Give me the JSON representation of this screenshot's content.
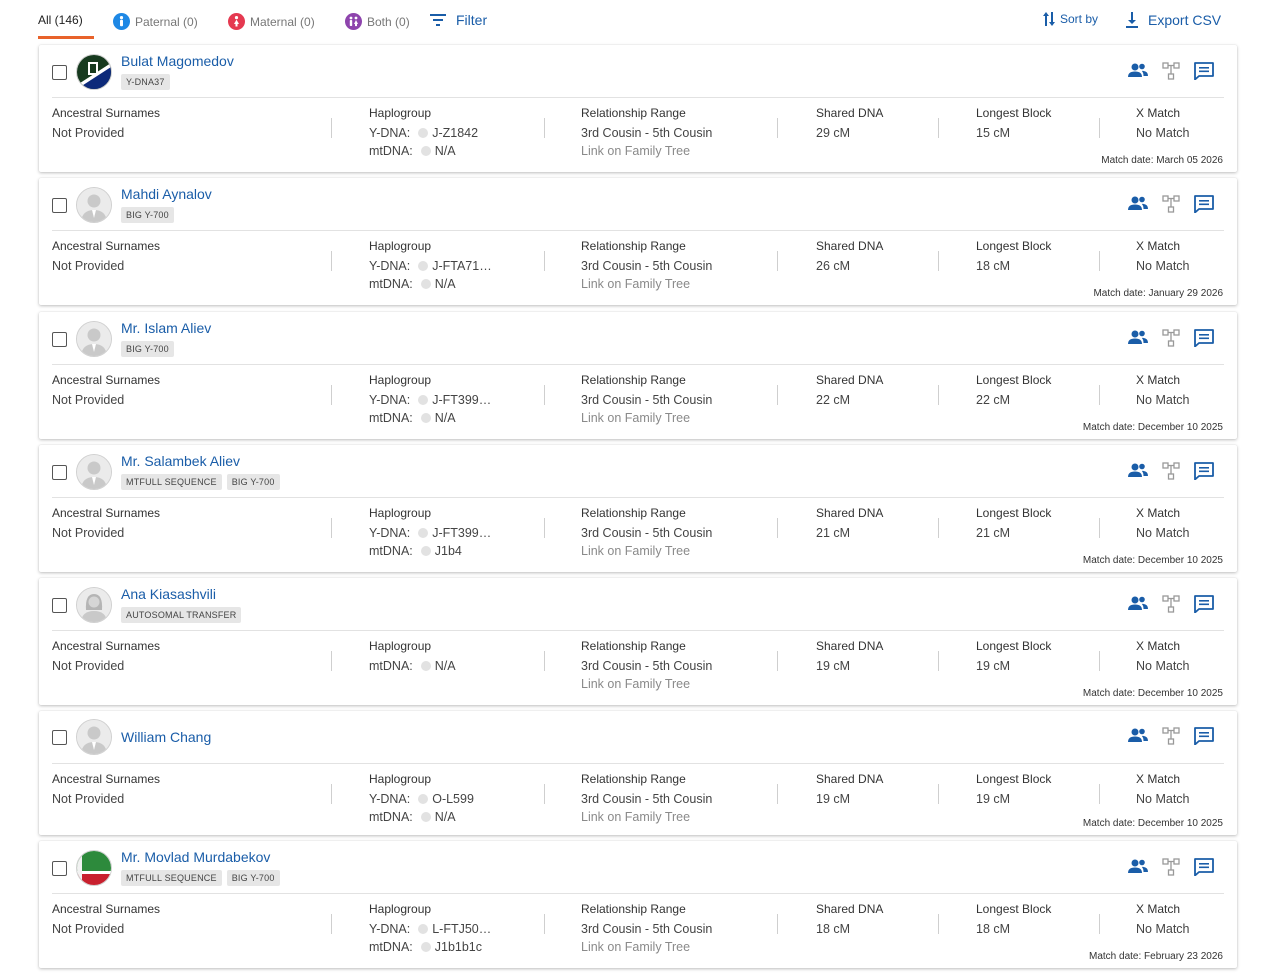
{
  "tabs": {
    "all": "All (146)",
    "paternal": "Paternal (0)",
    "maternal": "Maternal (0)",
    "both": "Both (0)"
  },
  "toolbar": {
    "filter": "Filter",
    "sort": "Sort by",
    "export": "Export CSV"
  },
  "colors": {
    "accent": "#1a5da8",
    "tab_active": "#e8622a",
    "paternal": "#1e88e5",
    "maternal": "#e53950",
    "both": "#8e44ad"
  },
  "labels": {
    "surnames": "Ancestral Surnames",
    "haplogroup": "Haplogroup",
    "relationship": "Relationship Range",
    "shared": "Shared DNA",
    "longest": "Longest Block",
    "xmatch": "X Match",
    "ydna": "Y-DNA:",
    "mtdna": "mtDNA:",
    "link": "Link on Family Tree"
  },
  "matches": [
    {
      "name": "Bulat Magomedov",
      "badges": [
        "Y-DNA37"
      ],
      "surnames": "Not Provided",
      "ydna": "J-Z1842",
      "mtdna": "N/A",
      "relationship": "3rd Cousin - 5th Cousin",
      "shared": "29 cM",
      "longest": "15 cM",
      "xmatch": "No Match",
      "date": "Match date: March 05 2026",
      "avatar": "flag-dark"
    },
    {
      "name": "Mahdi Aynalov",
      "badges": [
        "BIG Y-700"
      ],
      "surnames": "Not Provided",
      "ydna": "J-FTA71…",
      "mtdna": "N/A",
      "relationship": "3rd Cousin - 5th Cousin",
      "shared": "26 cM",
      "longest": "18 cM",
      "xmatch": "No Match",
      "date": "Match date: January 29 2026",
      "avatar": "male"
    },
    {
      "name": "Mr. Islam Aliev",
      "badges": [
        "BIG Y-700"
      ],
      "surnames": "Not Provided",
      "ydna": "J-FT399…",
      "mtdna": "N/A",
      "relationship": "3rd Cousin - 5th Cousin",
      "shared": "22 cM",
      "longest": "22 cM",
      "xmatch": "No Match",
      "date": "Match date: December 10 2025",
      "avatar": "male"
    },
    {
      "name": "Mr. Salambek Aliev",
      "badges": [
        "MTFULL SEQUENCE",
        "BIG Y-700"
      ],
      "surnames": "Not Provided",
      "ydna": "J-FT399…",
      "mtdna": "J1b4",
      "relationship": "3rd Cousin - 5th Cousin",
      "shared": "21 cM",
      "longest": "21 cM",
      "xmatch": "No Match",
      "date": "Match date: December 10 2025",
      "avatar": "male"
    },
    {
      "name": "Ana Kiasashvili",
      "badges": [
        "AUTOSOMAL TRANSFER"
      ],
      "surnames": "Not Provided",
      "ydna": "",
      "mtdna": "N/A",
      "relationship": "3rd Cousin - 5th Cousin",
      "shared": "19 cM",
      "longest": "19 cM",
      "xmatch": "No Match",
      "date": "Match date: December 10 2025",
      "avatar": "female"
    },
    {
      "name": "William Chang",
      "badges": [],
      "surnames": "Not Provided",
      "ydna": "O-L599",
      "mtdna": "N/A",
      "relationship": "3rd Cousin - 5th Cousin",
      "shared": "19 cM",
      "longest": "19 cM",
      "xmatch": "No Match",
      "date": "Match date: December 10 2025",
      "avatar": "male"
    },
    {
      "name": "Mr. Movlad Murdabekov",
      "badges": [
        "MTFULL SEQUENCE",
        "BIG Y-700"
      ],
      "surnames": "Not Provided",
      "ydna": "L-FTJ50…",
      "mtdna": "J1b1b1c",
      "relationship": "3rd Cousin - 5th Cousin",
      "shared": "18 cM",
      "longest": "18 cM",
      "xmatch": "No Match",
      "date": "Match date: February 23 2026",
      "avatar": "flag-chechen"
    }
  ]
}
